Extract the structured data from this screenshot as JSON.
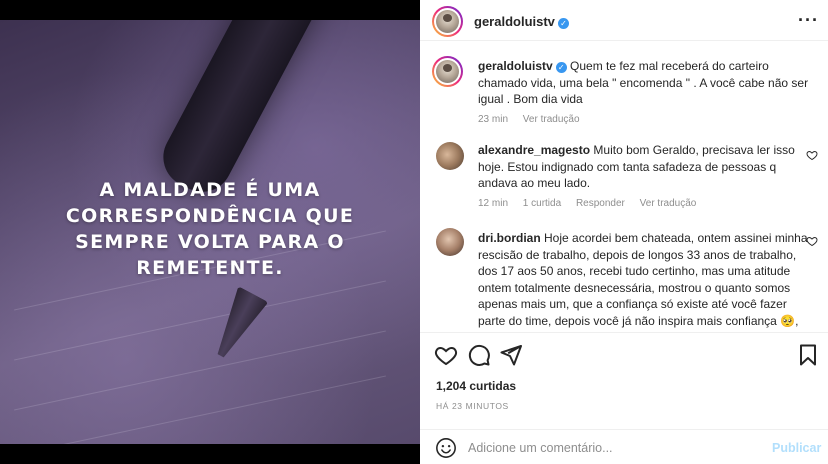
{
  "post": {
    "image_quote": "A MALDADE É UMA CORRESPONDÊNCIA QUE SEMPRE VOLTA PARA O REMETENTE."
  },
  "header": {
    "username": "geraldoluistv",
    "more_icon": "more-horizontal-icon"
  },
  "caption": {
    "username": "geraldoluistv",
    "text": "Quem te fez mal receberá do carteiro chamado vida, uma bela \" encomenda \" . A você cabe não ser igual . Bom dia vida",
    "time": "23 min",
    "translate": "Ver tradução"
  },
  "comments": [
    {
      "username": "alexandre_magesto",
      "text": "Muito bom Geraldo, precisava ler isso hoje. Estou indignado com tanta safadeza de pessoas q andava ao meu lado.",
      "time": "12 min",
      "likes": "1 curtida",
      "reply": "Responder",
      "translate": "Ver tradução"
    },
    {
      "username": "dri.bordian",
      "text": "Hoje acordei bem chateada, ontem assinei minha rescisão de trabalho, depois de longos 33 anos de trabalho, dos 17 aos 50 anos, recebi tudo certinho, mas uma atitude ontem totalmente desnecessária, mostrou o quanto somos apenas mais um, que a confiança só existe até você fazer parte do time, depois você já não inspira mais confiança 🥺, outras coisas tbm me chatearam, mas"
    }
  ],
  "actions": {
    "likes": "1,204 curtidas",
    "posted": "HÁ 23 MINUTOS"
  },
  "comment_box": {
    "placeholder": "Adicione um comentário...",
    "publish": "Publicar"
  },
  "colors": {
    "verified": "#3897f0",
    "publish_disabled": "#b2dffc",
    "muted": "#8e8e8e"
  }
}
